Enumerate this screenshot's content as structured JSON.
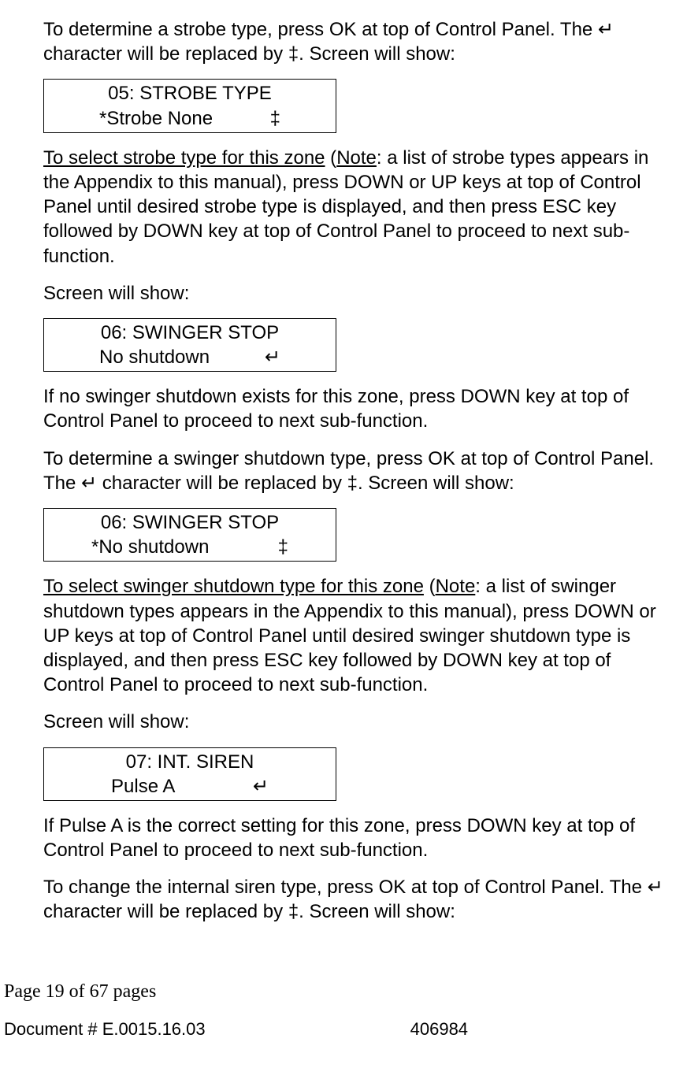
{
  "para1": "To determine a strobe type, press OK at top of Control Panel. The ↵ character will be replaced by ‡. Screen will show:",
  "screen1": {
    "line1": "05: STROBE TYPE",
    "line2_left": "*Strobe None",
    "line2_right": "‡"
  },
  "para2": {
    "u1": "To select strobe type for this zone",
    "mid1": " (",
    "u2": "Note",
    "rest": ": a list of strobe types appears in the Appendix to this manual), press DOWN or UP keys at top of Control Panel until desired strobe type is displayed, and then press ESC key followed by DOWN key at top of Control Panel to proceed to next sub-function."
  },
  "para3": "Screen will show:",
  "screen2": {
    "line1": "06: SWINGER STOP",
    "line2_left": "No shutdown",
    "line2_right": "↵"
  },
  "para4": "If no swinger shutdown exists for this zone, press DOWN key at top of Control Panel to proceed to next sub-function.",
  "para5": "To determine a swinger shutdown type, press OK at top of Control Panel. The ↵ character will be replaced by ‡. Screen will show:",
  "screen3": {
    "line1": "06: SWINGER STOP",
    "line2_left": "*No shutdown",
    "line2_right": "‡"
  },
  "para6": {
    "u1": "To select swinger shutdown type for this zone",
    "mid1": " (",
    "u2": "Note",
    "rest": ": a list of swinger shutdown types appears in the Appendix to this manual), press DOWN or UP keys at top of Control Panel until desired swinger shutdown type is displayed, and then press ESC key followed by DOWN key at top of Control Panel to proceed to next sub-function."
  },
  "para7": "Screen will show:",
  "screen4": {
    "line1": "07: INT. SIREN",
    "line2_left": "Pulse A",
    "line2_right": "↵"
  },
  "para8": "If Pulse A is the correct setting for this zone, press DOWN key at top of Control Panel to proceed to next sub-function.",
  "para9": "To change the internal siren type, press OK at top of Control Panel. The ↵ character will be replaced by ‡. Screen will show:",
  "footer": {
    "page": "Page 19 of  67 pages",
    "doc": "Document # E.0015.16.03",
    "rev": "406984"
  }
}
